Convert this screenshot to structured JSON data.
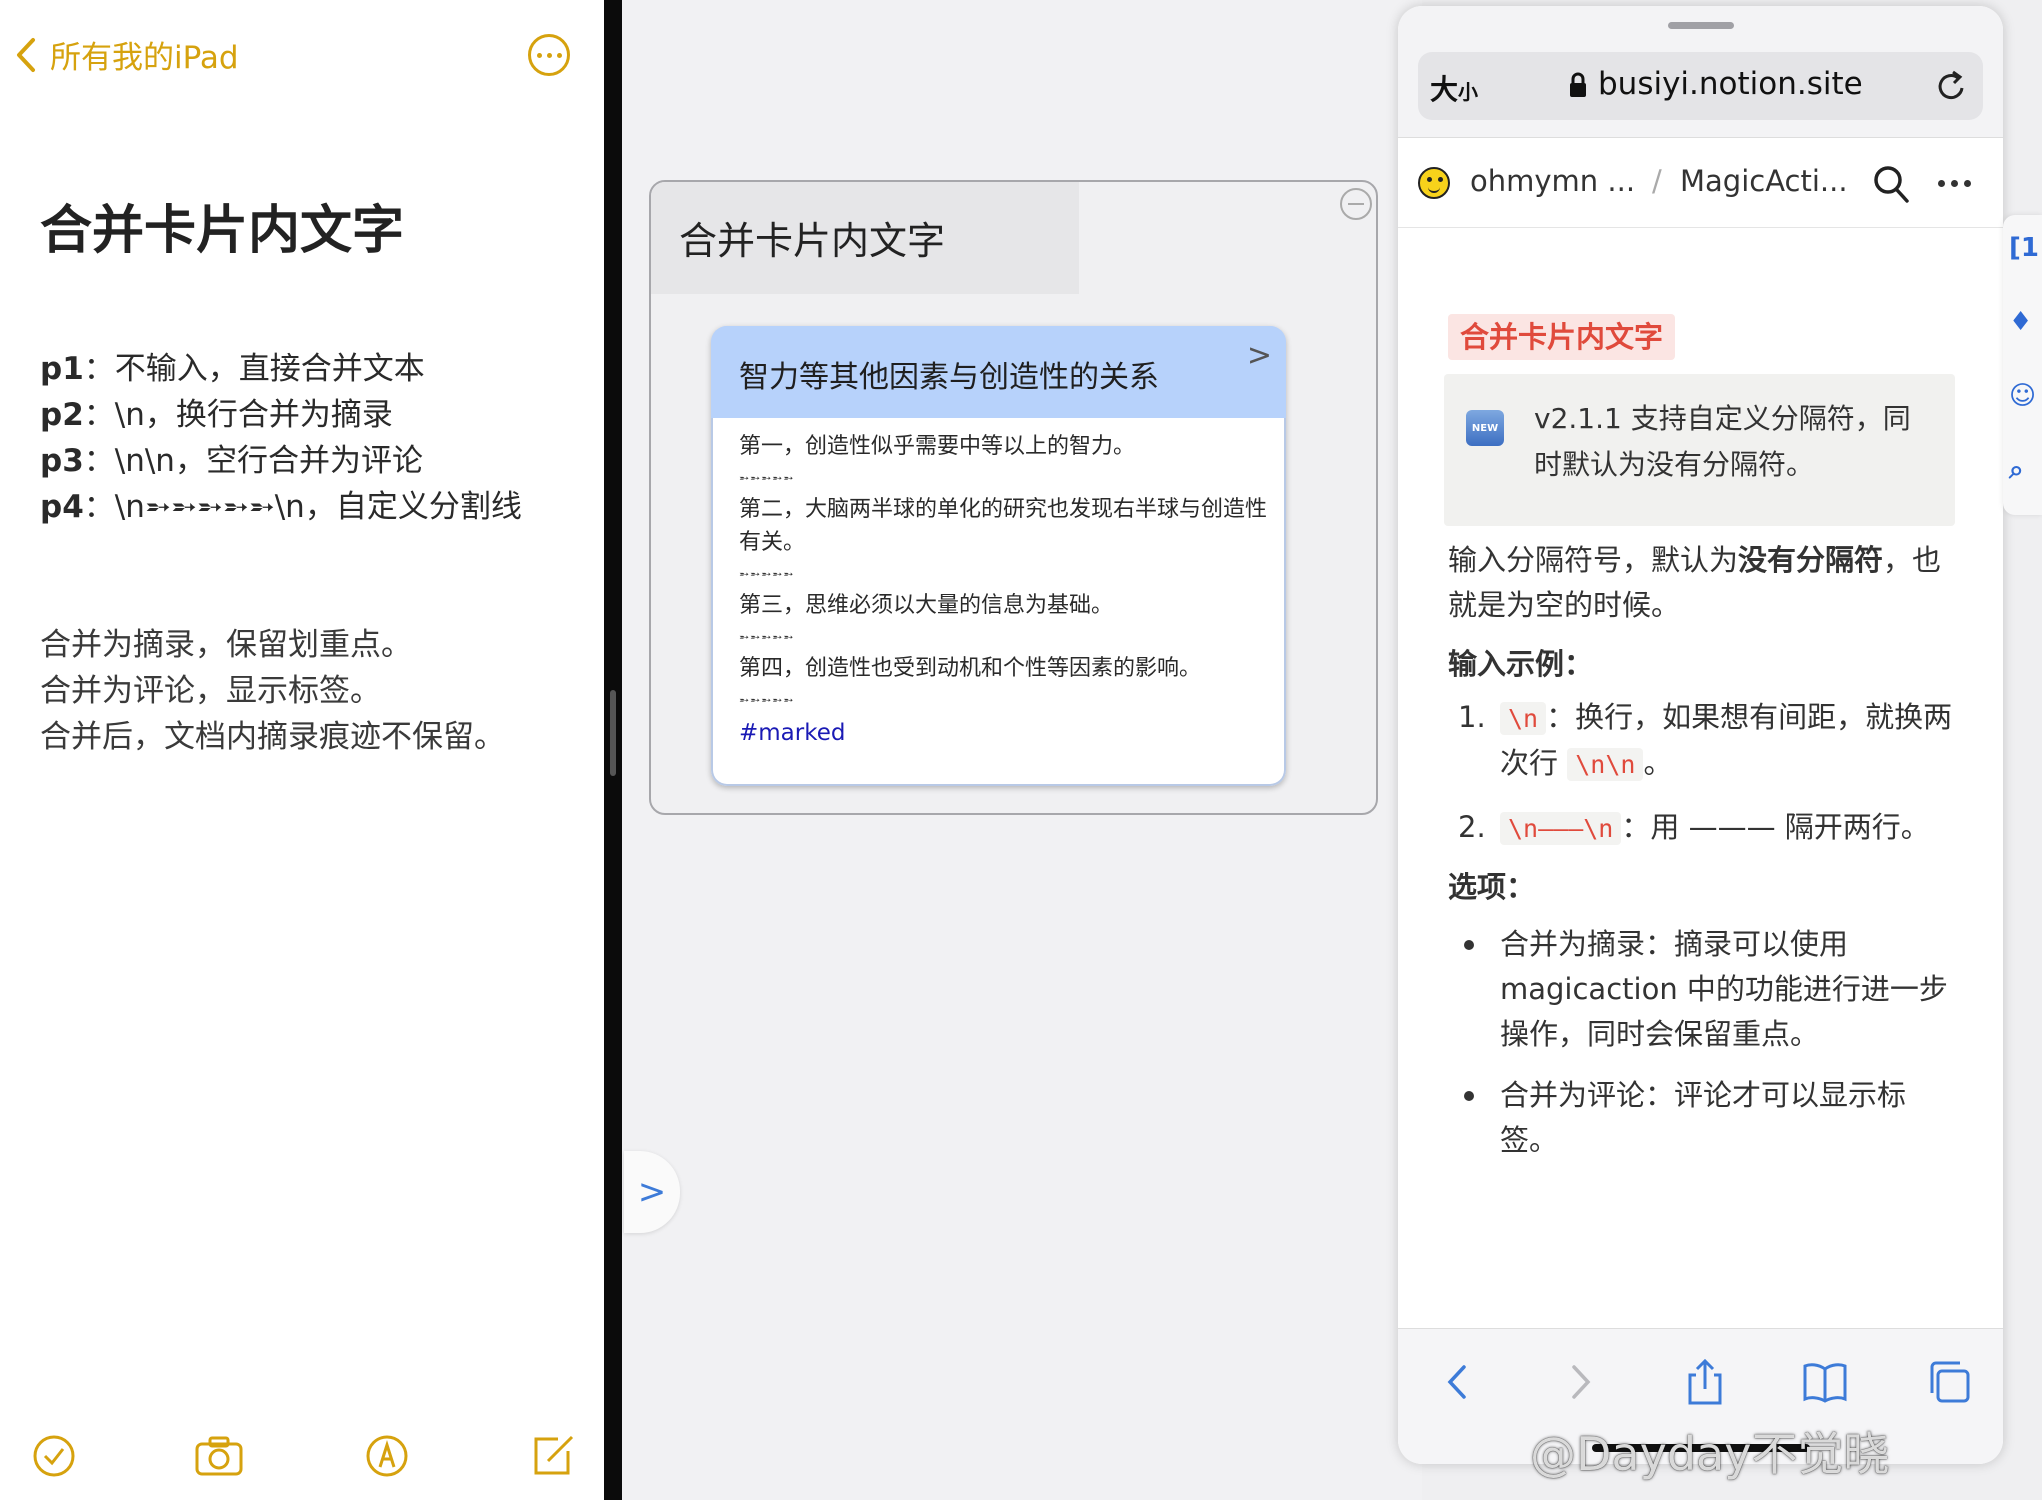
{
  "notes": {
    "back_label": "所有我的iPad",
    "title": "合并卡片内文字",
    "params": [
      {
        "key": "p1",
        "text": "：不输入，直接合并文本"
      },
      {
        "key": "p2",
        "text": "：\\n，换行合并为摘录"
      },
      {
        "key": "p3",
        "text": "：\\n\\n，空行合并为评论"
      },
      {
        "key": "p4",
        "text": "：\\n➵➵➵➵➵\\n，自定义分割线"
      }
    ],
    "desc": [
      "合并为摘录，保留划重点。",
      "合并为评论，显示标签。",
      "合并后，文档内摘录痕迹不保留。"
    ]
  },
  "canvas": {
    "card_title": "合并卡片内文字",
    "inner_title": "智力等其他因素与创造性的关系",
    "chevron": ">",
    "paragraphs": [
      "第一，创造性似乎需要中等以上的智力。",
      "第二，大脑两半球的单化的研究也发现右半球与创造性有关。",
      "第三，思维必须以大量的信息为基础。",
      "第四，创造性也受到动机和个性等因素的影响。"
    ],
    "separator": "➵➵➵➵➵",
    "tag": "#marked",
    "expand_chevron": ">"
  },
  "safari": {
    "text_size": "大小",
    "text_size_big": "大",
    "text_size_small": "小",
    "url": "busiyi.notion.site",
    "crumb1": "ohmymn ...",
    "crumb_sep": "/",
    "crumb2": "MagicActi...",
    "heading": "合并卡片内文字",
    "new_badge": "NEW",
    "callout": "v2.1.1 支持自定义分隔符，同时默认为没有分隔符。",
    "intro_a": "输入分隔符号，默认为",
    "intro_bold": "没有分隔符",
    "intro_b": "，也就是为空的时候。",
    "example_label": "输入示例：",
    "examples": [
      {
        "num": "1.",
        "code": "\\n",
        "a": "：换行，如果想有间距，就换两次行",
        "code2": "\\n\\n",
        "b": "。"
      },
      {
        "num": "2.",
        "code": "\\n———\\n",
        "a": "：用 ——— 隔开两行。"
      }
    ],
    "options_label": "选项：",
    "options": [
      "合并为摘录：摘录可以使用 magicaction 中的功能进行进一步操作，同时会保留重点。",
      "合并为评论：评论才可以显示标签。"
    ]
  },
  "edge_strip": [
    "[1",
    "♦",
    "☺",
    "⌕"
  ],
  "watermark": "@Dayday不觉晓",
  "colors": {
    "notes_accent": "#d6a20e",
    "card_header": "#b7d2fb",
    "notion_red": "#e04a3c",
    "safari_blue": "#3d7bd8"
  }
}
